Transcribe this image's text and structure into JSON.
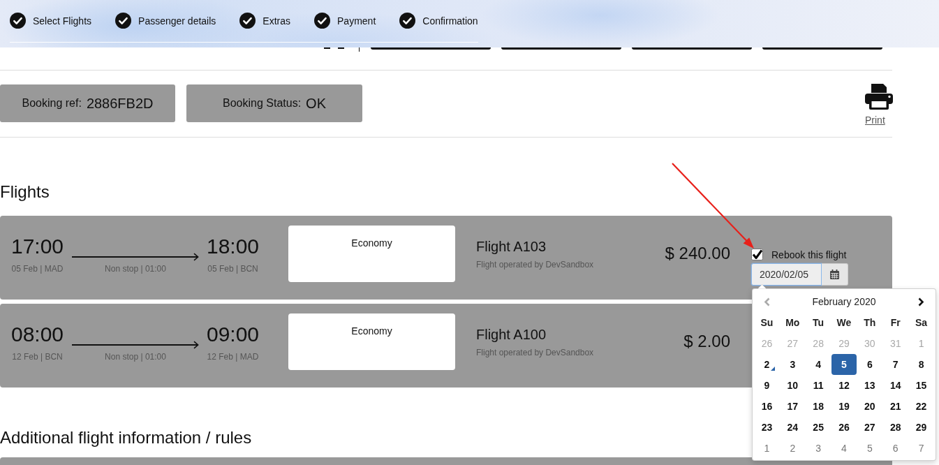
{
  "progress_steps": [
    {
      "label": "Select Flights",
      "completed": true
    },
    {
      "label": "Passenger details",
      "completed": true
    },
    {
      "label": "Extras",
      "completed": true
    },
    {
      "label": "Payment",
      "completed": true
    },
    {
      "label": "Confirmation",
      "completed": true
    }
  ],
  "booking": {
    "reference": {
      "label": "Booking ref:",
      "value": "2886FB2D"
    },
    "status": {
      "label": "Booking Status:",
      "value": "OK"
    },
    "print_link": "Print"
  },
  "flights_section": {
    "heading": "Flights",
    "flights": [
      {
        "departure_time": "17:00",
        "departure_info": "05 Feb | MAD",
        "route_info": "Non stop | 01:00",
        "arrival_time": "18:00",
        "arrival_info": "05 Feb | BCN",
        "fare_class": "Economy",
        "flight_number": "Flight A103",
        "operator": "Flight operated by DevSandbox",
        "price": "$ 240.00",
        "rebook": {
          "label": "Rebook this flight",
          "checked": true,
          "date": "2020/02/05",
          "focused": true,
          "datepicker": {
            "title": "February 2020",
            "prev_button": {
              "disabled": true
            },
            "next_button": {
              "disabled": false
            },
            "weekdays": [
              "Su",
              "Mo",
              "Tu",
              "We",
              "Th",
              "Fr",
              "Sa"
            ],
            "days": [
              {
                "label": "26",
                "selected": false,
                "today": false,
                "outside": true,
                "disabled": true
              },
              {
                "label": "27",
                "selected": false,
                "today": false,
                "outside": true,
                "disabled": true
              },
              {
                "label": "28",
                "selected": false,
                "today": false,
                "outside": true,
                "disabled": true
              },
              {
                "label": "29",
                "selected": false,
                "today": false,
                "outside": true,
                "disabled": true
              },
              {
                "label": "30",
                "selected": false,
                "today": false,
                "outside": true,
                "disabled": true
              },
              {
                "label": "31",
                "selected": false,
                "today": false,
                "outside": true,
                "disabled": true
              },
              {
                "label": "1",
                "selected": false,
                "today": false,
                "outside": false,
                "disabled": true
              },
              {
                "label": "2",
                "selected": false,
                "today": true,
                "outside": false,
                "disabled": false
              },
              {
                "label": "3",
                "selected": false,
                "today": false,
                "outside": false,
                "disabled": false
              },
              {
                "label": "4",
                "selected": false,
                "today": false,
                "outside": false,
                "disabled": false
              },
              {
                "label": "5",
                "selected": true,
                "today": false,
                "outside": false,
                "disabled": false
              },
              {
                "label": "6",
                "selected": false,
                "today": false,
                "outside": false,
                "disabled": false
              },
              {
                "label": "7",
                "selected": false,
                "today": false,
                "outside": false,
                "disabled": false
              },
              {
                "label": "8",
                "selected": false,
                "today": false,
                "outside": false,
                "disabled": false
              },
              {
                "label": "9",
                "selected": false,
                "today": false,
                "outside": false,
                "disabled": false
              },
              {
                "label": "10",
                "selected": false,
                "today": false,
                "outside": false,
                "disabled": false
              },
              {
                "label": "11",
                "selected": false,
                "today": false,
                "outside": false,
                "disabled": false
              },
              {
                "label": "12",
                "selected": false,
                "today": false,
                "outside": false,
                "disabled": false
              },
              {
                "label": "13",
                "selected": false,
                "today": false,
                "outside": false,
                "disabled": false
              },
              {
                "label": "14",
                "selected": false,
                "today": false,
                "outside": false,
                "disabled": false
              },
              {
                "label": "15",
                "selected": false,
                "today": false,
                "outside": false,
                "disabled": false
              },
              {
                "label": "16",
                "selected": false,
                "today": false,
                "outside": false,
                "disabled": false
              },
              {
                "label": "17",
                "selected": false,
                "today": false,
                "outside": false,
                "disabled": false
              },
              {
                "label": "18",
                "selected": false,
                "today": false,
                "outside": false,
                "disabled": false
              },
              {
                "label": "19",
                "selected": false,
                "today": false,
                "outside": false,
                "disabled": false
              },
              {
                "label": "20",
                "selected": false,
                "today": false,
                "outside": false,
                "disabled": false
              },
              {
                "label": "21",
                "selected": false,
                "today": false,
                "outside": false,
                "disabled": false
              },
              {
                "label": "22",
                "selected": false,
                "today": false,
                "outside": false,
                "disabled": false
              },
              {
                "label": "23",
                "selected": false,
                "today": false,
                "outside": false,
                "disabled": false
              },
              {
                "label": "24",
                "selected": false,
                "today": false,
                "outside": false,
                "disabled": false
              },
              {
                "label": "25",
                "selected": false,
                "today": false,
                "outside": false,
                "disabled": false
              },
              {
                "label": "26",
                "selected": false,
                "today": false,
                "outside": false,
                "disabled": false
              },
              {
                "label": "27",
                "selected": false,
                "today": false,
                "outside": false,
                "disabled": false
              },
              {
                "label": "28",
                "selected": false,
                "today": false,
                "outside": false,
                "disabled": false
              },
              {
                "label": "29",
                "selected": false,
                "today": false,
                "outside": false,
                "disabled": false
              },
              {
                "label": "1",
                "selected": false,
                "today": false,
                "outside": true,
                "disabled": false
              },
              {
                "label": "2",
                "selected": false,
                "today": false,
                "outside": true,
                "disabled": false
              },
              {
                "label": "3",
                "selected": false,
                "today": false,
                "outside": true,
                "disabled": false
              },
              {
                "label": "4",
                "selected": false,
                "today": false,
                "outside": true,
                "disabled": false
              },
              {
                "label": "5",
                "selected": false,
                "today": false,
                "outside": true,
                "disabled": false
              },
              {
                "label": "6",
                "selected": false,
                "today": false,
                "outside": true,
                "disabled": false
              },
              {
                "label": "7",
                "selected": false,
                "today": false,
                "outside": true,
                "disabled": false
              }
            ]
          }
        }
      },
      {
        "departure_time": "08:00",
        "departure_info": "12 Feb | BCN",
        "route_info": "Non stop | 01:00",
        "arrival_time": "09:00",
        "arrival_info": "12 Feb | MAD",
        "fare_class": "Economy",
        "flight_number": "Flight A100",
        "operator": "Flight operated by DevSandbox",
        "price": "$ 2.00"
      }
    ]
  },
  "additional_section": {
    "heading": "Additional flight information / rules"
  }
}
